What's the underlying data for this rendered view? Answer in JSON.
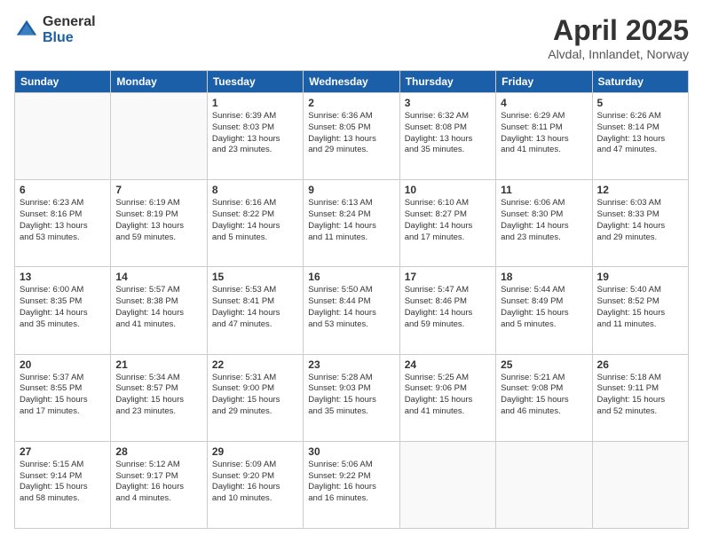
{
  "logo": {
    "general": "General",
    "blue": "Blue"
  },
  "header": {
    "title": "April 2025",
    "subtitle": "Alvdal, Innlandet, Norway"
  },
  "weekdays": [
    "Sunday",
    "Monday",
    "Tuesday",
    "Wednesday",
    "Thursday",
    "Friday",
    "Saturday"
  ],
  "weeks": [
    [
      {
        "day": "",
        "detail": ""
      },
      {
        "day": "",
        "detail": ""
      },
      {
        "day": "1",
        "detail": "Sunrise: 6:39 AM\nSunset: 8:03 PM\nDaylight: 13 hours\nand 23 minutes."
      },
      {
        "day": "2",
        "detail": "Sunrise: 6:36 AM\nSunset: 8:05 PM\nDaylight: 13 hours\nand 29 minutes."
      },
      {
        "day": "3",
        "detail": "Sunrise: 6:32 AM\nSunset: 8:08 PM\nDaylight: 13 hours\nand 35 minutes."
      },
      {
        "day": "4",
        "detail": "Sunrise: 6:29 AM\nSunset: 8:11 PM\nDaylight: 13 hours\nand 41 minutes."
      },
      {
        "day": "5",
        "detail": "Sunrise: 6:26 AM\nSunset: 8:14 PM\nDaylight: 13 hours\nand 47 minutes."
      }
    ],
    [
      {
        "day": "6",
        "detail": "Sunrise: 6:23 AM\nSunset: 8:16 PM\nDaylight: 13 hours\nand 53 minutes."
      },
      {
        "day": "7",
        "detail": "Sunrise: 6:19 AM\nSunset: 8:19 PM\nDaylight: 13 hours\nand 59 minutes."
      },
      {
        "day": "8",
        "detail": "Sunrise: 6:16 AM\nSunset: 8:22 PM\nDaylight: 14 hours\nand 5 minutes."
      },
      {
        "day": "9",
        "detail": "Sunrise: 6:13 AM\nSunset: 8:24 PM\nDaylight: 14 hours\nand 11 minutes."
      },
      {
        "day": "10",
        "detail": "Sunrise: 6:10 AM\nSunset: 8:27 PM\nDaylight: 14 hours\nand 17 minutes."
      },
      {
        "day": "11",
        "detail": "Sunrise: 6:06 AM\nSunset: 8:30 PM\nDaylight: 14 hours\nand 23 minutes."
      },
      {
        "day": "12",
        "detail": "Sunrise: 6:03 AM\nSunset: 8:33 PM\nDaylight: 14 hours\nand 29 minutes."
      }
    ],
    [
      {
        "day": "13",
        "detail": "Sunrise: 6:00 AM\nSunset: 8:35 PM\nDaylight: 14 hours\nand 35 minutes."
      },
      {
        "day": "14",
        "detail": "Sunrise: 5:57 AM\nSunset: 8:38 PM\nDaylight: 14 hours\nand 41 minutes."
      },
      {
        "day": "15",
        "detail": "Sunrise: 5:53 AM\nSunset: 8:41 PM\nDaylight: 14 hours\nand 47 minutes."
      },
      {
        "day": "16",
        "detail": "Sunrise: 5:50 AM\nSunset: 8:44 PM\nDaylight: 14 hours\nand 53 minutes."
      },
      {
        "day": "17",
        "detail": "Sunrise: 5:47 AM\nSunset: 8:46 PM\nDaylight: 14 hours\nand 59 minutes."
      },
      {
        "day": "18",
        "detail": "Sunrise: 5:44 AM\nSunset: 8:49 PM\nDaylight: 15 hours\nand 5 minutes."
      },
      {
        "day": "19",
        "detail": "Sunrise: 5:40 AM\nSunset: 8:52 PM\nDaylight: 15 hours\nand 11 minutes."
      }
    ],
    [
      {
        "day": "20",
        "detail": "Sunrise: 5:37 AM\nSunset: 8:55 PM\nDaylight: 15 hours\nand 17 minutes."
      },
      {
        "day": "21",
        "detail": "Sunrise: 5:34 AM\nSunset: 8:57 PM\nDaylight: 15 hours\nand 23 minutes."
      },
      {
        "day": "22",
        "detail": "Sunrise: 5:31 AM\nSunset: 9:00 PM\nDaylight: 15 hours\nand 29 minutes."
      },
      {
        "day": "23",
        "detail": "Sunrise: 5:28 AM\nSunset: 9:03 PM\nDaylight: 15 hours\nand 35 minutes."
      },
      {
        "day": "24",
        "detail": "Sunrise: 5:25 AM\nSunset: 9:06 PM\nDaylight: 15 hours\nand 41 minutes."
      },
      {
        "day": "25",
        "detail": "Sunrise: 5:21 AM\nSunset: 9:08 PM\nDaylight: 15 hours\nand 46 minutes."
      },
      {
        "day": "26",
        "detail": "Sunrise: 5:18 AM\nSunset: 9:11 PM\nDaylight: 15 hours\nand 52 minutes."
      }
    ],
    [
      {
        "day": "27",
        "detail": "Sunrise: 5:15 AM\nSunset: 9:14 PM\nDaylight: 15 hours\nand 58 minutes."
      },
      {
        "day": "28",
        "detail": "Sunrise: 5:12 AM\nSunset: 9:17 PM\nDaylight: 16 hours\nand 4 minutes."
      },
      {
        "day": "29",
        "detail": "Sunrise: 5:09 AM\nSunset: 9:20 PM\nDaylight: 16 hours\nand 10 minutes."
      },
      {
        "day": "30",
        "detail": "Sunrise: 5:06 AM\nSunset: 9:22 PM\nDaylight: 16 hours\nand 16 minutes."
      },
      {
        "day": "",
        "detail": ""
      },
      {
        "day": "",
        "detail": ""
      },
      {
        "day": "",
        "detail": ""
      }
    ]
  ]
}
